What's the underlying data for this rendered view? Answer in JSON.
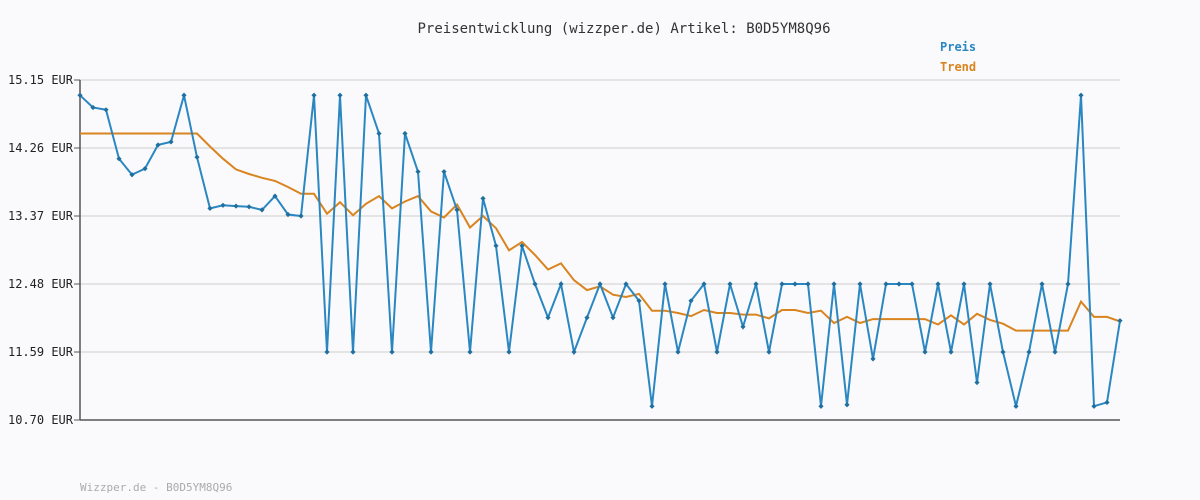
{
  "chart_data": {
    "type": "line",
    "title": "Preisentwicklung (wizzper.de) Artikel: B0D5YM8Q96",
    "y_ticks": [
      "10.70 EUR",
      "11.59 EUR",
      "12.48 EUR",
      "13.37 EUR",
      "14.26 EUR",
      "15.15 EUR"
    ],
    "ylim": [
      10.7,
      15.15
    ],
    "grid": true,
    "legend_position": "top-right",
    "footer": "Wizzper.de - B0D5YM8Q96",
    "colors": {
      "preis": "#2a87c2",
      "trend": "#d9841f"
    },
    "series": [
      {
        "name": "Preis",
        "values": [
          14.95,
          14.79,
          14.76,
          14.12,
          13.91,
          13.99,
          14.3,
          14.34,
          14.95,
          14.14,
          13.47,
          13.51,
          13.5,
          13.49,
          13.45,
          13.63,
          13.39,
          13.37,
          14.95,
          11.59,
          14.95,
          11.59,
          14.95,
          14.45,
          11.59,
          14.45,
          13.95,
          11.59,
          13.95,
          13.45,
          11.59,
          13.6,
          12.98,
          11.59,
          12.98,
          12.48,
          12.04,
          12.48,
          11.59,
          12.04,
          12.48,
          12.04,
          12.48,
          12.26,
          10.88,
          12.48,
          11.59,
          12.26,
          12.48,
          11.59,
          12.48,
          11.92,
          12.48,
          11.59,
          12.48,
          12.48,
          12.48,
          10.88,
          12.48,
          10.9,
          12.48,
          11.5,
          12.48,
          12.48,
          12.48,
          11.59,
          12.48,
          11.59,
          12.48,
          11.19,
          12.48,
          11.59,
          10.88,
          11.59,
          12.48,
          11.59,
          12.48,
          14.95,
          10.88,
          10.93,
          12.0
        ]
      },
      {
        "name": "Trend",
        "values": [
          14.45,
          14.45,
          14.45,
          14.45,
          14.45,
          14.45,
          14.45,
          14.45,
          14.45,
          14.45,
          14.28,
          14.12,
          13.98,
          13.92,
          13.87,
          13.83,
          13.75,
          13.66,
          13.66,
          13.4,
          13.55,
          13.38,
          13.53,
          13.63,
          13.47,
          13.56,
          13.63,
          13.43,
          13.35,
          13.52,
          13.22,
          13.37,
          13.21,
          12.92,
          13.03,
          12.86,
          12.67,
          12.75,
          12.53,
          12.4,
          12.45,
          12.34,
          12.31,
          12.35,
          12.13,
          12.13,
          12.1,
          12.06,
          12.14,
          12.1,
          12.1,
          12.08,
          12.08,
          12.03,
          12.14,
          12.14,
          12.1,
          12.13,
          11.97,
          12.05,
          11.97,
          12.02,
          12.02,
          12.02,
          12.02,
          12.02,
          11.95,
          12.07,
          11.95,
          12.09,
          12.01,
          11.96,
          11.87,
          11.87,
          11.87,
          11.87,
          11.87,
          12.25,
          12.05,
          12.05,
          11.99
        ]
      }
    ]
  }
}
